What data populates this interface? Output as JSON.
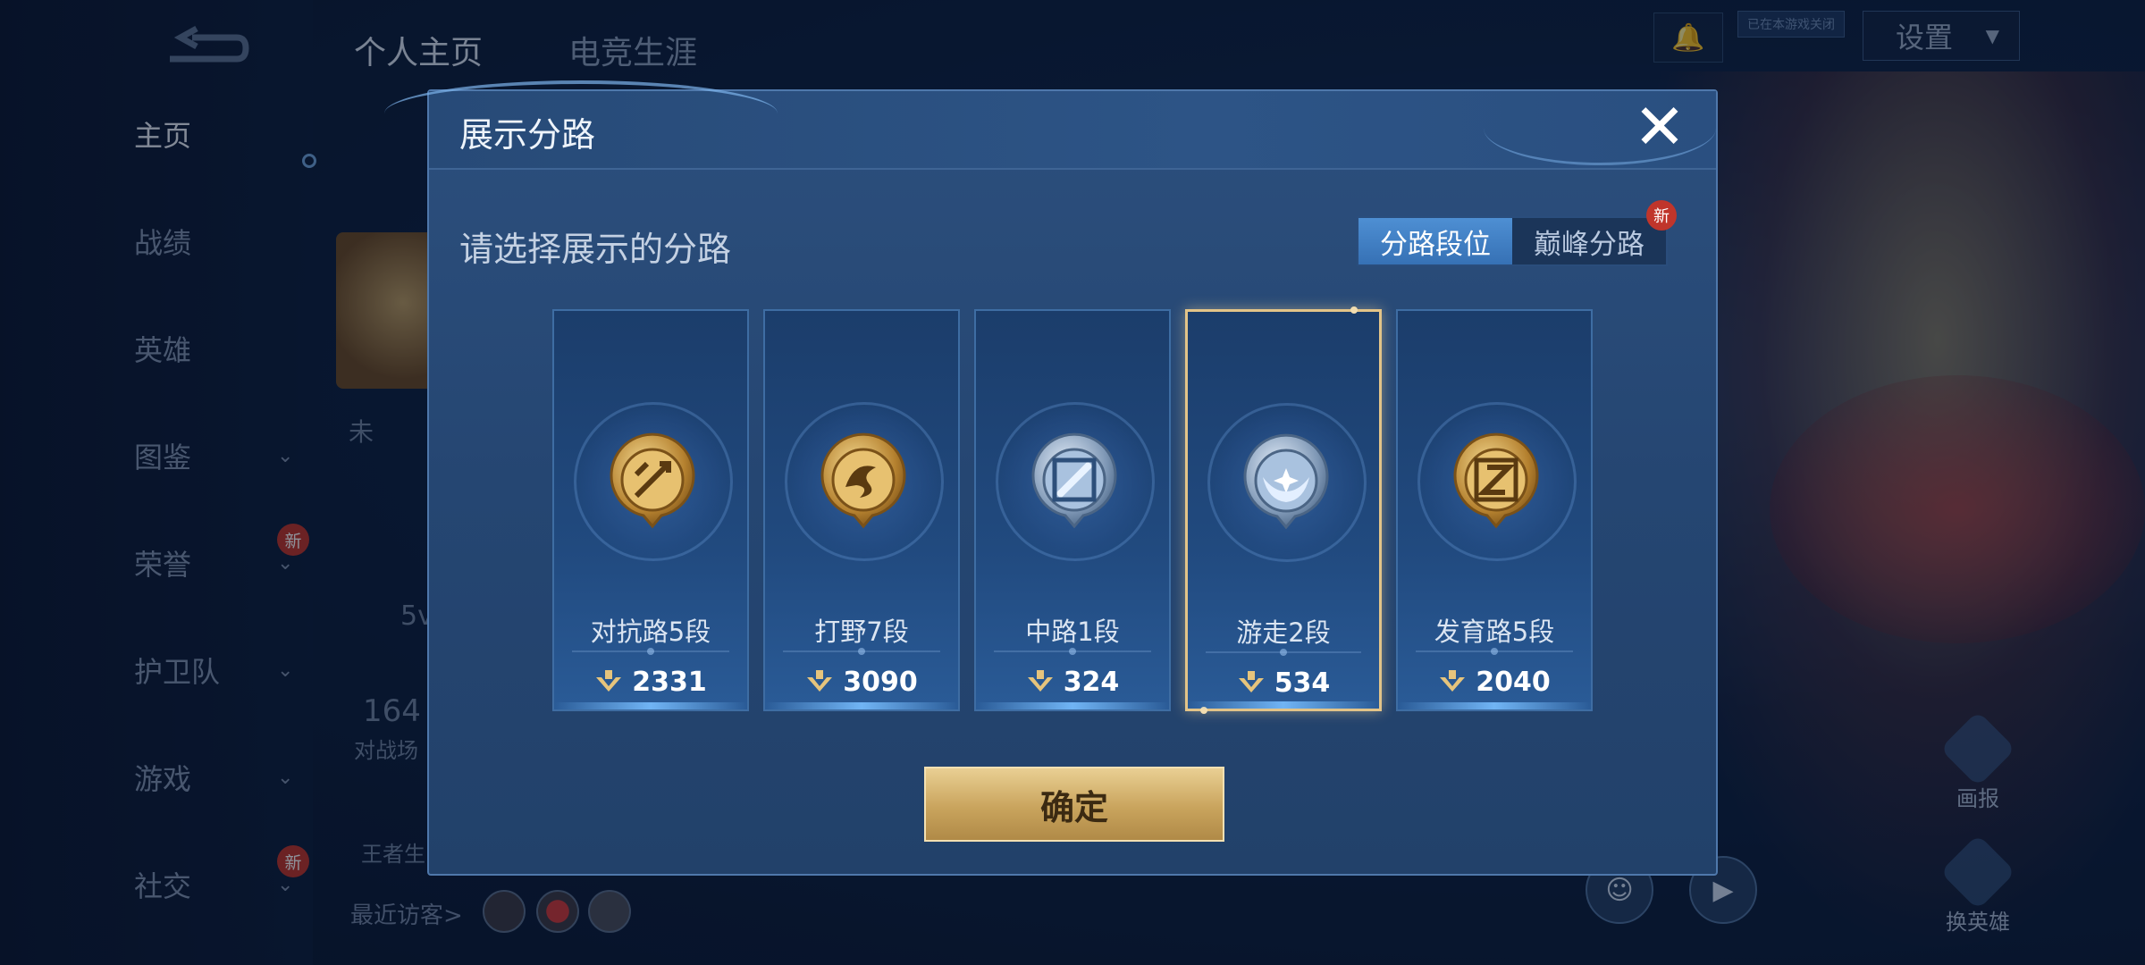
{
  "background": {
    "top_tabs": [
      "个人主页",
      "电竞生涯"
    ],
    "nav_items": [
      {
        "label": "主页",
        "active": true,
        "chevron": false,
        "new": false
      },
      {
        "label": "战绩",
        "active": false,
        "chevron": false,
        "new": false
      },
      {
        "label": "英雄",
        "active": false,
        "chevron": false,
        "new": false
      },
      {
        "label": "图鉴",
        "active": false,
        "chevron": true,
        "new": false
      },
      {
        "label": "荣誉",
        "active": false,
        "chevron": true,
        "new": true
      },
      {
        "label": "护卫队",
        "active": false,
        "chevron": true,
        "new": false
      },
      {
        "label": "游戏",
        "active": false,
        "chevron": true,
        "new": false
      },
      {
        "label": "社交",
        "active": false,
        "chevron": true,
        "new": true
      }
    ],
    "new_badge": "新",
    "settings_label": "设置",
    "friend_tip": "已在本游戏关闭",
    "status_text": "未",
    "stat_5v": "5v",
    "stat_164": "164",
    "stat_label": "对战场",
    "stat_wz": "王者生",
    "visitors_label": "最近访客>",
    "side_actions": [
      "画报",
      "换英雄"
    ]
  },
  "modal": {
    "title": "展示分路",
    "subtitle": "请选择展示的分路",
    "close_icon": "close-icon",
    "segments": [
      {
        "label": "分路段位",
        "active": true,
        "new": false
      },
      {
        "label": "巅峰分路",
        "active": false,
        "new": true
      }
    ],
    "new_badge": "新",
    "lanes": [
      {
        "name": "对抗路5段",
        "score": "2331",
        "icon": "clash-lane-emblem",
        "tier": "gold",
        "selected": false
      },
      {
        "name": "打野7段",
        "score": "3090",
        "icon": "jungle-emblem",
        "tier": "gold",
        "selected": false
      },
      {
        "name": "中路1段",
        "score": "324",
        "icon": "mid-lane-emblem",
        "tier": "silver",
        "selected": false
      },
      {
        "name": "游走2段",
        "score": "534",
        "icon": "roam-emblem",
        "tier": "silver",
        "selected": true
      },
      {
        "name": "发育路5段",
        "score": "2040",
        "icon": "farm-lane-emblem",
        "tier": "gold",
        "selected": false
      }
    ],
    "confirm_label": "确定"
  },
  "colors": {
    "gold": "#d9b25c",
    "silver": "#b9cbe0",
    "selected_border": "#e3c488",
    "primary": "#3671b5"
  }
}
